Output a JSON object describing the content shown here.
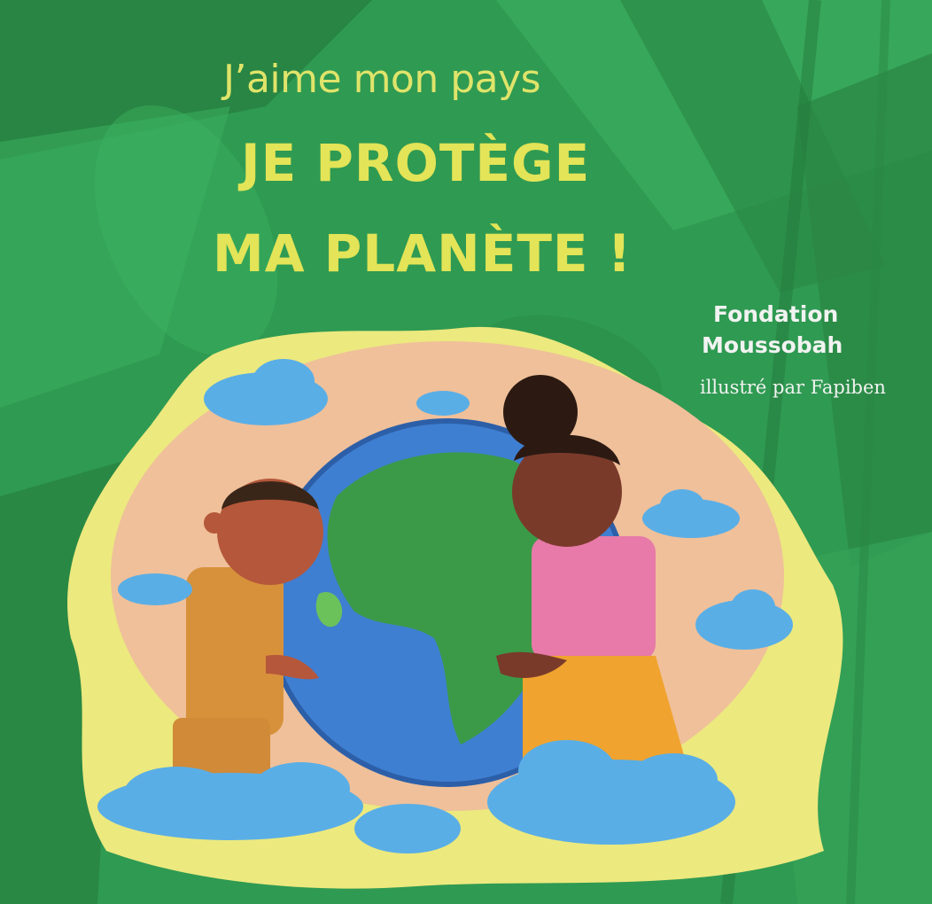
{
  "cover": {
    "title_line1": "J’aime mon pays",
    "title_line2": "JE PROTÈGE",
    "title_line3": "MA PLANÈTE !",
    "author_line1": "Fondation",
    "author_line2": "Moussobah",
    "illustrator": "illustré par Fapiben"
  },
  "colors": {
    "background": "#2f9a52",
    "title": "#e3e457",
    "author": "#f1f3f1",
    "halo_yellow": "#ece97e",
    "halo_peach": "#efc09a",
    "ocean": "#3f7fd1",
    "land": "#3a9a48",
    "cloud": "#5aaee6"
  },
  "icons": [
    "leaf-icon",
    "globe-icon",
    "cloud-icon",
    "boy-icon",
    "girl-icon"
  ]
}
